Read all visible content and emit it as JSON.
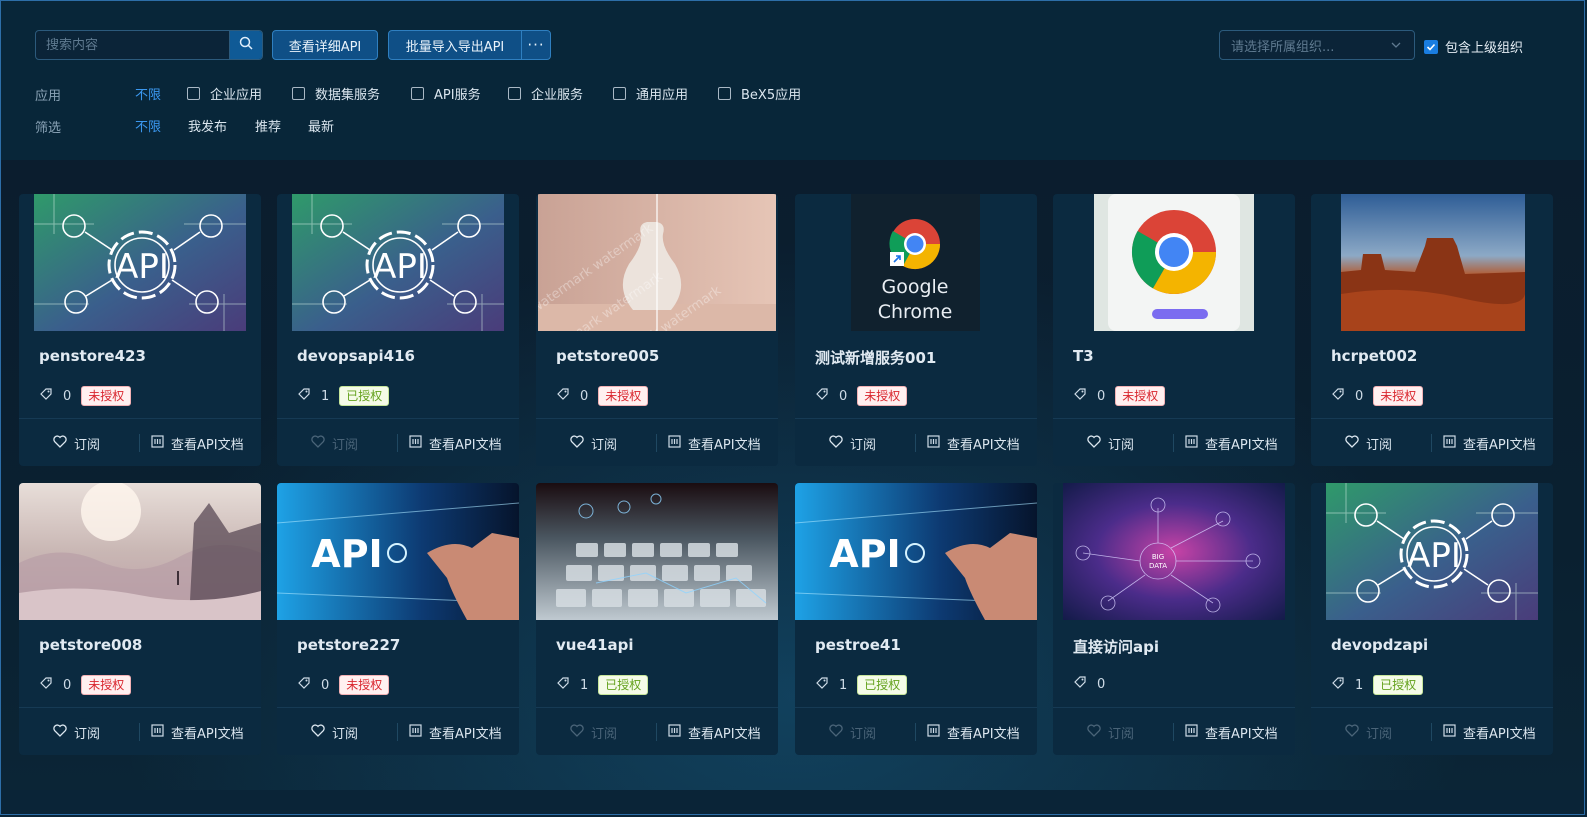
{
  "search": {
    "placeholder": "搜索内容"
  },
  "toolbar": {
    "detail_api": "查看详细API",
    "batch_import_export": "批量导入导出API",
    "more": "···"
  },
  "org": {
    "placeholder": "请选择所属组织...",
    "include_parent_label": "包含上级组织",
    "include_parent_checked": true
  },
  "filters": {
    "app_label": "应用",
    "app_options": [
      "不限",
      "企业应用",
      "数据集服务",
      "API服务",
      "企业服务",
      "通用应用",
      "BeX5应用"
    ],
    "screen_label": "筛选",
    "screen_options": [
      "不限",
      "我发布",
      "推荐",
      "最新"
    ]
  },
  "actions": {
    "subscribe": "订阅",
    "view_docs": "查看API文档"
  },
  "cards": [
    {
      "title": "penstore423",
      "count": "0",
      "status": "未授权",
      "image": "api-circuit"
    },
    {
      "title": "devopsapi416",
      "count": "1",
      "status": "已授权",
      "image": "api-circuit"
    },
    {
      "title": "petstore005",
      "count": "0",
      "status": "未授权",
      "image": "vase-watermark",
      "watermark": "watermark"
    },
    {
      "title": "测试新增服务001",
      "count": "0",
      "status": "未授权",
      "image": "chrome-shortcut",
      "image_text_1": "Google",
      "image_text_2": "Chrome"
    },
    {
      "title": "T3",
      "count": "0",
      "status": "未授权",
      "image": "chrome-logo"
    },
    {
      "title": "hcrpet002",
      "count": "0",
      "status": "未授权",
      "image": "desert-mesa"
    },
    {
      "title": "petstore008",
      "count": "0",
      "status": "未授权",
      "image": "misty-landscape"
    },
    {
      "title": "petstore227",
      "count": "0",
      "status": "未授权",
      "image": "api-hand",
      "image_text": "API"
    },
    {
      "title": "vue41api",
      "count": "1",
      "status": "已授权",
      "image": "keyboard-data"
    },
    {
      "title": "pestroe41",
      "count": "1",
      "status": "已授权",
      "image": "api-hand",
      "image_text": "API"
    },
    {
      "title": "直接访问api",
      "count": "0",
      "status": "",
      "image": "big-data",
      "image_text_1": "BIG",
      "image_text_2": "DATA"
    },
    {
      "title": "devopdzapi",
      "count": "1",
      "status": "已授权",
      "image": "api-circuit"
    }
  ],
  "colors": {
    "accent": "#3b98f0",
    "button": "#0f4f86",
    "unauth": "#d9262e",
    "auth": "#64a21d"
  }
}
